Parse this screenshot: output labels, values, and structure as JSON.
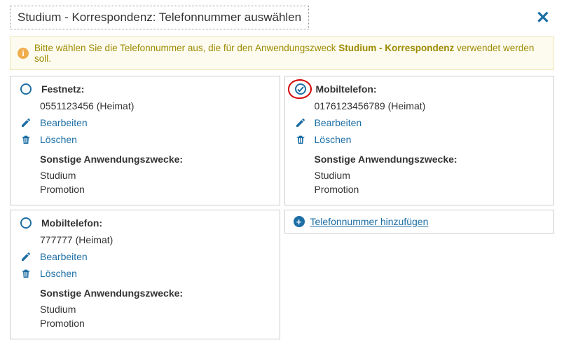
{
  "header": {
    "title": "Studium - Korrespondenz: Telefonnummer auswählen"
  },
  "info": {
    "prefix": "Bitte wählen Sie die Telefonnummer aus, die für den Anwendungszweck ",
    "bold": "Studium - Korrespondenz",
    "suffix": " verwendet werden soll."
  },
  "labels": {
    "edit": "Bearbeiten",
    "delete": "Löschen",
    "other_uses": "Sonstige Anwendungszwecke:",
    "add": "Telefonnummer hinzufügen"
  },
  "cards": [
    {
      "type": "Festnetz:",
      "number": "0551123456 (Heimat)",
      "selected": false,
      "uses": [
        "Studium",
        "Promotion"
      ]
    },
    {
      "type": "Mobiltelefon:",
      "number": "0176123456789 (Heimat)",
      "selected": true,
      "uses": [
        "Studium",
        "Promotion"
      ]
    },
    {
      "type": "Mobiltelefon:",
      "number": "777777 (Heimat)",
      "selected": false,
      "uses": [
        "Studium",
        "Promotion"
      ]
    }
  ]
}
